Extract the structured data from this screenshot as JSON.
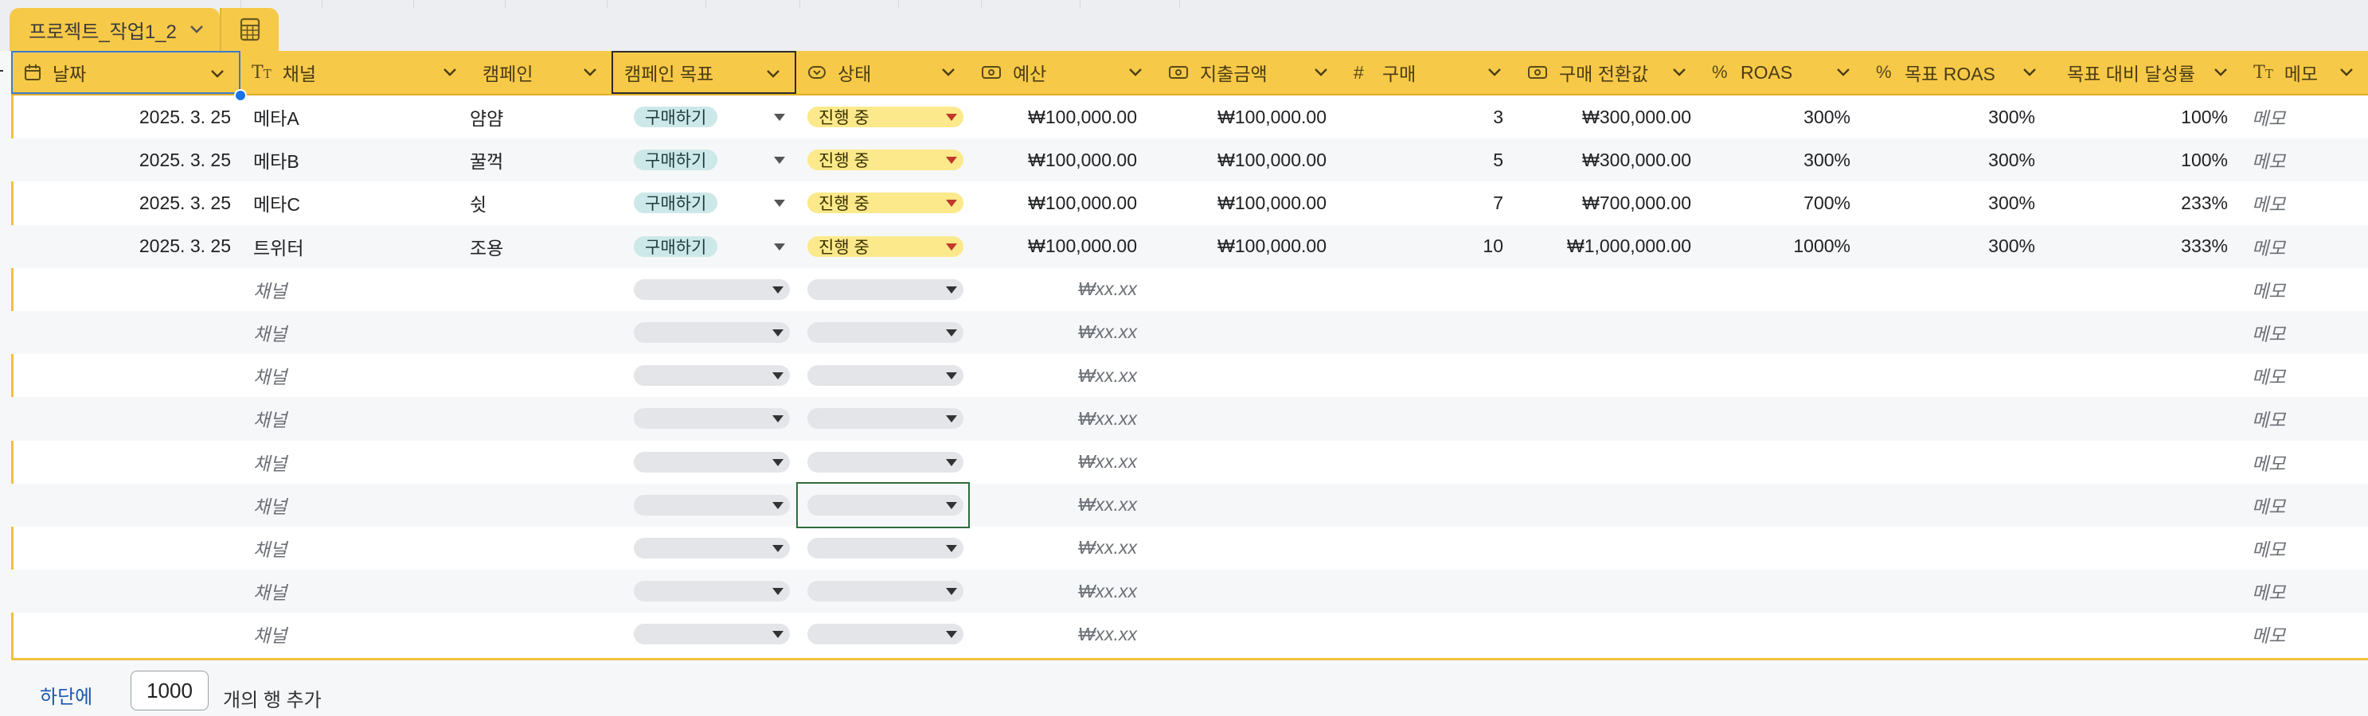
{
  "tab": {
    "name": "프로젝트_작업1_2"
  },
  "columns": [
    {
      "key": "date",
      "label": "날짜",
      "icon": "calendar-icon"
    },
    {
      "key": "channel",
      "label": "채널",
      "icon": "text-type-icon"
    },
    {
      "key": "campaign",
      "label": "캠페인",
      "icon": ""
    },
    {
      "key": "goal",
      "label": "캠페인 목표",
      "icon": ""
    },
    {
      "key": "status",
      "label": "상태",
      "icon": "dropdown-chip-icon"
    },
    {
      "key": "budget",
      "label": "예산",
      "icon": "money-icon"
    },
    {
      "key": "spend",
      "label": "지출금액",
      "icon": "money-icon"
    },
    {
      "key": "purchases",
      "label": "구매",
      "icon": "hash-icon"
    },
    {
      "key": "conv_value",
      "label": "구매 전환값",
      "icon": "money-icon"
    },
    {
      "key": "roas",
      "label": "ROAS",
      "icon": "percent-icon"
    },
    {
      "key": "target_roas",
      "label": "목표 ROAS",
      "icon": "percent-icon"
    },
    {
      "key": "achievement",
      "label": "목표 대비 달성률",
      "icon": ""
    },
    {
      "key": "memo",
      "label": "메모",
      "icon": "text-type-icon"
    }
  ],
  "rows": [
    {
      "date": "2025. 3. 25",
      "channel": "메타A",
      "campaign": "얌얌",
      "goal": "구매하기",
      "status": "진행 중",
      "budget": "₩100,000.00",
      "spend": "₩100,000.00",
      "purchases": "3",
      "conv_value": "₩300,000.00",
      "roas": "300%",
      "target_roas": "300%",
      "achievement": "100%",
      "memo": "메모"
    },
    {
      "date": "2025. 3. 25",
      "channel": "메타B",
      "campaign": "꿀꺽",
      "goal": "구매하기",
      "status": "진행 중",
      "budget": "₩100,000.00",
      "spend": "₩100,000.00",
      "purchases": "5",
      "conv_value": "₩300,000.00",
      "roas": "300%",
      "target_roas": "300%",
      "achievement": "100%",
      "memo": "메모"
    },
    {
      "date": "2025. 3. 25",
      "channel": "메타C",
      "campaign": "쉿",
      "goal": "구매하기",
      "status": "진행 중",
      "budget": "₩100,000.00",
      "spend": "₩100,000.00",
      "purchases": "7",
      "conv_value": "₩700,000.00",
      "roas": "700%",
      "target_roas": "300%",
      "achievement": "233%",
      "memo": "메모"
    },
    {
      "date": "2025. 3. 25",
      "channel": "트위터",
      "campaign": "조용",
      "goal": "구매하기",
      "status": "진행 중",
      "budget": "₩100,000.00",
      "spend": "₩100,000.00",
      "purchases": "10",
      "conv_value": "₩1,000,000.00",
      "roas": "1000%",
      "target_roas": "300%",
      "achievement": "333%",
      "memo": "메모"
    }
  ],
  "placeholders": {
    "channel": "채널",
    "budget": "₩xx.xx",
    "memo": "메모"
  },
  "empty_row_count": 9,
  "footer": {
    "link": "하단에",
    "row_count": "1000",
    "suffix": "개의 행 추가"
  },
  "colors": {
    "header": "#f7c948",
    "goal_pill": "#cde8e8",
    "status_pill": "#fbe98b",
    "selection": "#2f6b3f"
  }
}
